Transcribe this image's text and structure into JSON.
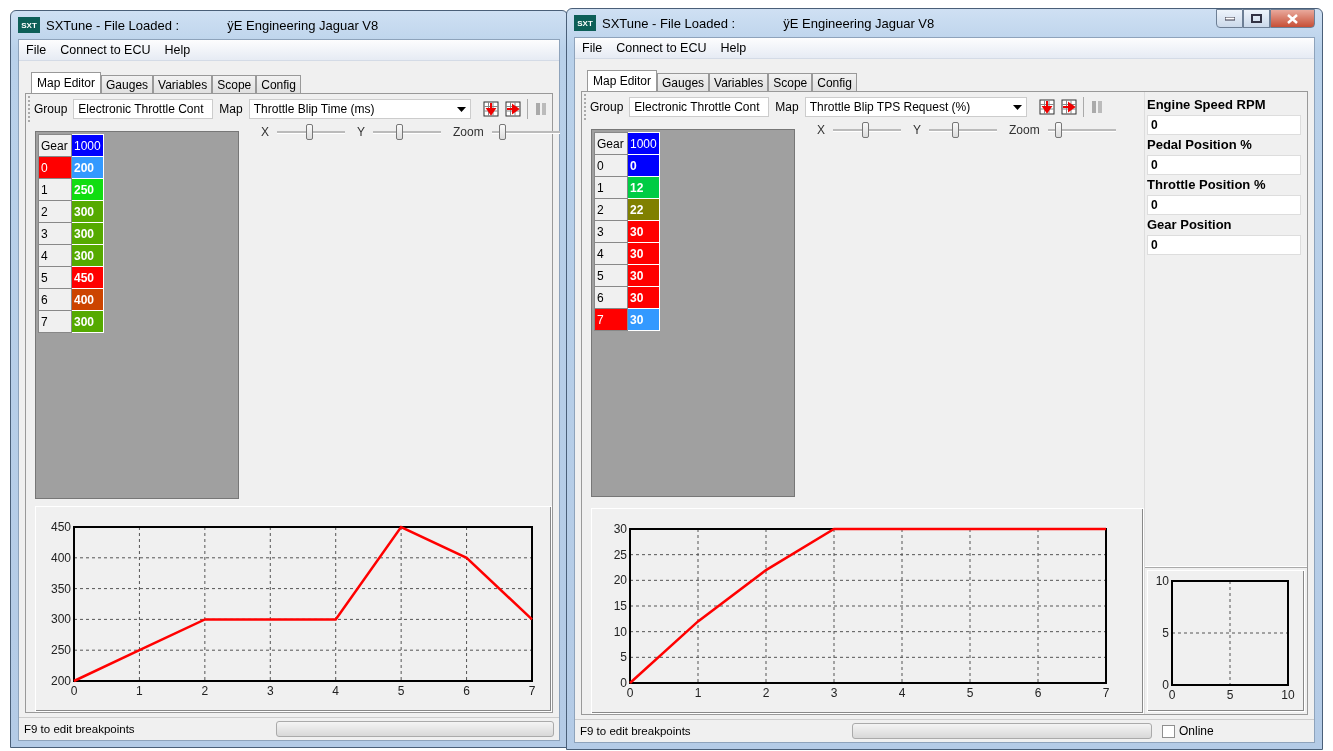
{
  "windows": [
    {
      "logo": "SXT",
      "title": "SXTune - File Loaded :",
      "file": "ÿE Engineering Jaguar V8",
      "menu": [
        "File",
        "Connect to ECU",
        "Help"
      ],
      "tabs": [
        {
          "label": "Map Editor",
          "selected": true
        },
        {
          "label": "Gauges",
          "selected": false
        },
        {
          "label": "Variables",
          "selected": false
        },
        {
          "label": "Scope",
          "selected": false
        },
        {
          "label": "Config",
          "selected": false
        }
      ],
      "toolbar": {
        "group_label": "Group",
        "group_value": "Electronic Throttle Cont",
        "map_label": "Map",
        "map_value": "Throttle Blip Time (ms)"
      },
      "sliders": [
        {
          "label": "X",
          "level": 0.47
        },
        {
          "label": "Y",
          "level": 0.38
        },
        {
          "label": "Zoom",
          "level": 0.12
        }
      ],
      "table": {
        "header": [
          "Gear",
          "1000"
        ],
        "rows": [
          {
            "gear": "0",
            "value": "200",
            "color": "#3399ff",
            "selected": true
          },
          {
            "gear": "1",
            "value": "250",
            "color": "#11dd11",
            "selected": false
          },
          {
            "gear": "2",
            "value": "300",
            "color": "#55aa00",
            "selected": false
          },
          {
            "gear": "3",
            "value": "300",
            "color": "#55aa00",
            "selected": false
          },
          {
            "gear": "4",
            "value": "300",
            "color": "#55aa00",
            "selected": false
          },
          {
            "gear": "5",
            "value": "450",
            "color": "#ff0000",
            "selected": false
          },
          {
            "gear": "6",
            "value": "400",
            "color": "#cc4400",
            "selected": false
          },
          {
            "gear": "7",
            "value": "300",
            "color": "#55aa00",
            "selected": false
          }
        ]
      },
      "chart_data": {
        "type": "line",
        "grid": true,
        "x": [
          0,
          1,
          2,
          3,
          4,
          5,
          6,
          7
        ],
        "values": [
          200,
          250,
          300,
          300,
          300,
          450,
          400,
          300
        ],
        "xlim": [
          0,
          7
        ],
        "ylim": [
          200,
          450
        ],
        "xticks": [
          0,
          1,
          2,
          3,
          4,
          5,
          6,
          7
        ],
        "yticks": [
          200,
          250,
          300,
          350,
          400,
          450
        ]
      },
      "status_bar": {
        "text": "F9 to edit breakpoints",
        "progress": {
          "level": 0
        }
      }
    },
    {
      "logo": "SXT",
      "title": "SXTune - File Loaded :",
      "file": "ÿE Engineering Jaguar V8",
      "controls": true,
      "menu": [
        "File",
        "Connect to ECU",
        "Help"
      ],
      "tabs": [
        {
          "label": "Map Editor",
          "selected": true
        },
        {
          "label": "Gauges",
          "selected": false
        },
        {
          "label": "Variables",
          "selected": false
        },
        {
          "label": "Scope",
          "selected": false
        },
        {
          "label": "Config",
          "selected": false
        }
      ],
      "toolbar": {
        "group_label": "Group",
        "group_value": "Electronic Throttle Cont",
        "map_label": "Map",
        "map_value": "Throttle Blip TPS Request (%)"
      },
      "sliders": [
        {
          "label": "X",
          "level": 0.48
        },
        {
          "label": "Y",
          "level": 0.38
        },
        {
          "label": "Zoom",
          "level": 0.12
        }
      ],
      "table": {
        "header": [
          "Gear",
          "1000"
        ],
        "rows": [
          {
            "gear": "0",
            "value": "0",
            "color": "#0000ff",
            "selected": false
          },
          {
            "gear": "1",
            "value": "12",
            "color": "#00cc44",
            "selected": false
          },
          {
            "gear": "2",
            "value": "22",
            "color": "#808000",
            "selected": false
          },
          {
            "gear": "3",
            "value": "30",
            "color": "#ff0000",
            "selected": false
          },
          {
            "gear": "4",
            "value": "30",
            "color": "#ff0000",
            "selected": false
          },
          {
            "gear": "5",
            "value": "30",
            "color": "#ff0000",
            "selected": false
          },
          {
            "gear": "6",
            "value": "30",
            "color": "#ff0000",
            "selected": false
          },
          {
            "gear": "7",
            "value": "30",
            "color": "#3399ff",
            "selected": true
          }
        ]
      },
      "chart_data": {
        "type": "line",
        "grid": true,
        "x": [
          0,
          1,
          2,
          3,
          4,
          5,
          6,
          7
        ],
        "values": [
          0,
          12,
          22,
          30,
          30,
          30,
          30,
          30
        ],
        "xlim": [
          0,
          7
        ],
        "ylim": [
          0,
          30
        ],
        "xticks": [
          0,
          1,
          2,
          3,
          4,
          5,
          6,
          7
        ],
        "yticks": [
          0,
          5,
          10,
          15,
          20,
          25,
          30
        ]
      },
      "gauges": [
        {
          "label": "Engine Speed RPM",
          "value": "0"
        },
        {
          "label": "Pedal Position %",
          "value": "0"
        },
        {
          "label": "Throttle Position %",
          "value": "0"
        },
        {
          "label": "Gear Position",
          "value": "0"
        }
      ],
      "mini_chart": {
        "chart_data": {
          "type": "line",
          "grid": true,
          "xlim": [
            0,
            10
          ],
          "ylim": [
            0,
            10
          ],
          "xticks": [
            0,
            5,
            10
          ],
          "yticks": [
            0,
            5,
            10
          ]
        }
      },
      "status_bar": {
        "text": "F9 to edit breakpoints",
        "progress": {
          "level": 0
        },
        "online": {
          "label": "Online",
          "checked": false
        }
      }
    }
  ]
}
